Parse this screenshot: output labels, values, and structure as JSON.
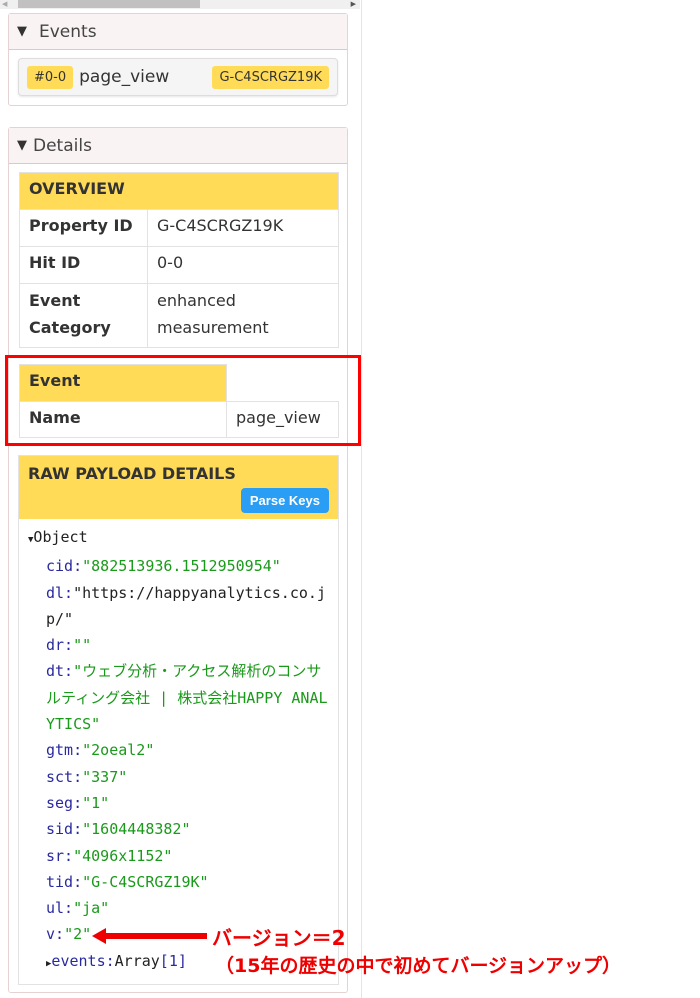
{
  "events_panel": {
    "title": "Events",
    "event": {
      "index": "#0-0",
      "name": "page_view",
      "property": "G-C4SCRGZ19K"
    }
  },
  "details_panel": {
    "title": "Details",
    "overview": {
      "header": "OVERVIEW",
      "rows": [
        {
          "k": "Property ID",
          "v": "G-C4SCRGZ19K"
        },
        {
          "k": "Hit ID",
          "v": "0-0"
        },
        {
          "k": "Event Category",
          "v": "enhanced measurement"
        }
      ]
    },
    "event": {
      "header": "Event",
      "rows": [
        {
          "k": "Name",
          "v": "page_view"
        }
      ]
    },
    "raw": {
      "header": "RAW PAYLOAD DETAILS",
      "parse_button": "Parse Keys",
      "root": "Object",
      "fields": [
        {
          "k": "cid:",
          "v": "\"882513936.1512950954\"",
          "c": "str"
        },
        {
          "k": "dl:",
          "v": "\"https://happyanalytics.co.jp/\"",
          "c": "blk"
        },
        {
          "k": "dr:",
          "v": "\"\"",
          "c": "str"
        },
        {
          "k": "dt:",
          "v": "\"ウェブ分析・アクセス解析のコンサルティング会社 | 株式会社HAPPY ANALYTICS\"",
          "c": "str"
        },
        {
          "k": "gtm:",
          "v": "\"2oeal2\"",
          "c": "str"
        },
        {
          "k": "sct:",
          "v": "\"337\"",
          "c": "str"
        },
        {
          "k": "seg:",
          "v": "\"1\"",
          "c": "str"
        },
        {
          "k": "sid:",
          "v": "\"1604448382\"",
          "c": "str"
        },
        {
          "k": "sr:",
          "v": "\"4096x1152\"",
          "c": "str"
        },
        {
          "k": "tid:",
          "v": "\"G-C4SCRGZ19K\"",
          "c": "str"
        },
        {
          "k": "ul:",
          "v": "\"ja\"",
          "c": "str"
        },
        {
          "k": "v:",
          "v": "\"2\"",
          "c": "str"
        }
      ],
      "events_key": "events:",
      "events_val": "Array",
      "events_count": "[1]"
    }
  },
  "annotation": {
    "line1": "バージョン＝2",
    "line2": "（15年の歴史の中で初めてバージョンアップ）",
    "color": "#ee0000"
  }
}
